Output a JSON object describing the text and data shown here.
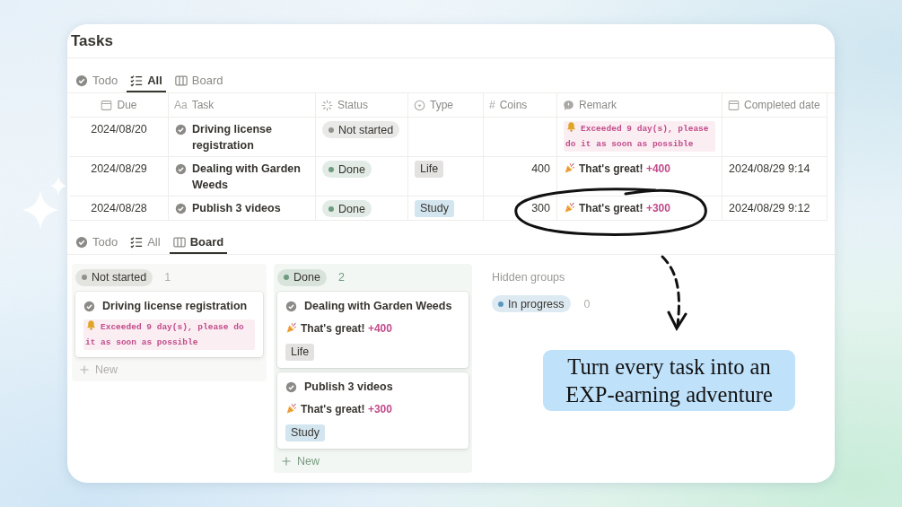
{
  "title": "Tasks",
  "table_view": {
    "tabs": [
      {
        "label": "Todo",
        "selected": false
      },
      {
        "label": "All",
        "selected": true
      },
      {
        "label": "Board",
        "selected": false
      }
    ],
    "columns": [
      {
        "label": "Due"
      },
      {
        "label": "Task",
        "glyph": "Aa"
      },
      {
        "label": "Status"
      },
      {
        "label": "Type"
      },
      {
        "label": "Coins",
        "glyph": "#"
      },
      {
        "label": "Remark"
      },
      {
        "label": "Completed date"
      }
    ],
    "rows": [
      {
        "due": "2024/08/20",
        "task": "Driving license registration",
        "status": {
          "label": "Not started",
          "color": "#91918e"
        },
        "coins": "",
        "remark": {
          "kind": "warning",
          "text": "Exceeded 9 day(s), please do it as soon as possible"
        }
      },
      {
        "due": "2024/08/29",
        "task": "Dealing with Garden Weeds",
        "status": {
          "label": "Done",
          "color": "#6c9b7d"
        },
        "type": {
          "label": "Life",
          "color": "#e3e2e0"
        },
        "coins": "400",
        "remark": {
          "kind": "reward",
          "text": "That's great!",
          "amount": "+400"
        },
        "completed": "2024/08/29 9:14"
      },
      {
        "due": "2024/08/28",
        "task": "Publish 3 videos",
        "status": {
          "label": "Done",
          "color": "#6c9b7d"
        },
        "type": {
          "label": "Study",
          "color": "#d3e5ef"
        },
        "coins": "300",
        "remark": {
          "kind": "reward",
          "text": "That's great!",
          "amount": "+300"
        },
        "completed": "2024/08/29 9:12"
      }
    ]
  },
  "board_view": {
    "tabs": [
      {
        "label": "Todo",
        "selected": false
      },
      {
        "label": "All",
        "selected": false
      },
      {
        "label": "Board",
        "selected": true
      }
    ],
    "groups": [
      {
        "label": "Not started",
        "color": "#91918e",
        "count": "1",
        "cards": [
          {
            "task": "Driving license registration",
            "remark": {
              "kind": "warning",
              "text": "Exceeded 9 day(s), please do it as soon as possible"
            }
          }
        ],
        "new_label": "New"
      },
      {
        "label": "Done",
        "color": "#6c9b7d",
        "count": "2",
        "cards": [
          {
            "task": "Dealing with Garden Weeds",
            "remark": {
              "kind": "reward",
              "text": "That's great!",
              "amount": "+400"
            },
            "type": {
              "label": "Life",
              "color": "#e3e2e0"
            }
          },
          {
            "task": "Publish 3 videos",
            "remark": {
              "kind": "reward",
              "text": "That's great!",
              "amount": "+300"
            },
            "type": {
              "label": "Study",
              "color": "#d3e5ef"
            }
          }
        ],
        "new_label": "New"
      }
    ],
    "hidden": {
      "label": "Hidden groups",
      "groups": [
        {
          "label": "In progress",
          "color": "#5b97bd",
          "count": "0"
        }
      ]
    }
  },
  "callout": "Turn every task into an EXP-earning adventure"
}
